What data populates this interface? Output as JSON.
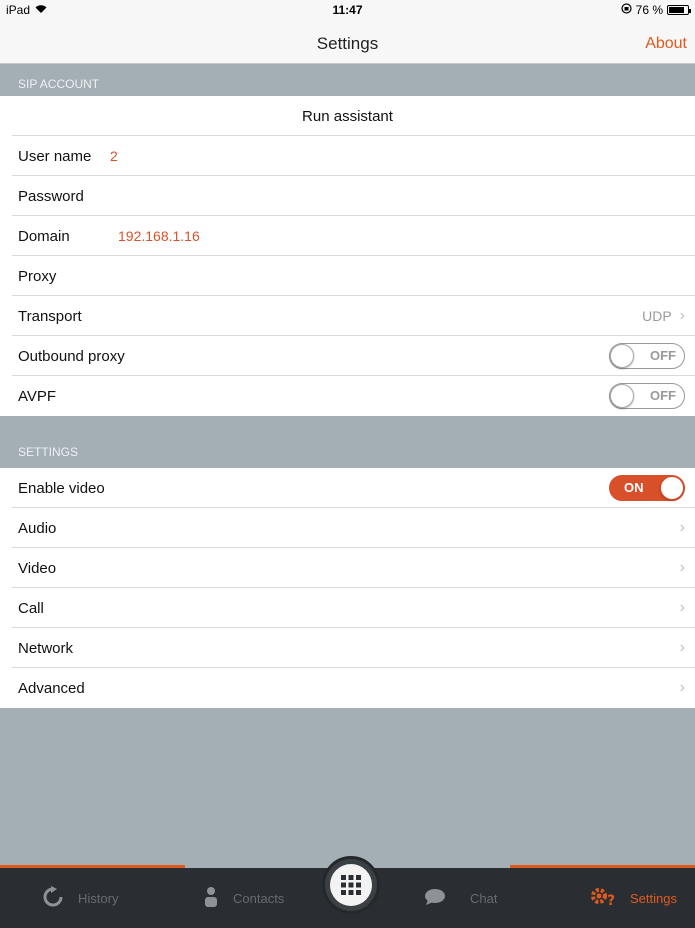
{
  "status_bar": {
    "device": "iPad",
    "time": "11:47",
    "battery": "76 %"
  },
  "nav": {
    "title": "Settings",
    "about": "About"
  },
  "sip_section": {
    "header": "SIP ACCOUNT"
  },
  "sip": {
    "run_assistant": "Run assistant",
    "username_label": "User name",
    "username_value": "2",
    "password_label": "Password",
    "domain_label": "Domain",
    "domain_value": "192.168.1.16",
    "proxy_label": "Proxy",
    "transport_label": "Transport",
    "transport_value": "UDP",
    "outbound_label": "Outbound proxy",
    "outbound_state": "OFF",
    "avpf_label": "AVPF",
    "avpf_state": "OFF"
  },
  "settings_section": {
    "header": "SETTINGS"
  },
  "settings": {
    "enable_video_label": "Enable video",
    "enable_video_state": "ON",
    "audio": "Audio",
    "video": "Video",
    "call": "Call",
    "network": "Network",
    "advanced": "Advanced"
  },
  "tabbar": {
    "history": "History",
    "contacts": "Contacts",
    "chat": "Chat",
    "settings": "Settings"
  },
  "colors": {
    "accent": "#e05a1e",
    "switch_on": "#d8502a",
    "section_bg": "#a4aeb5",
    "tabbar_bg": "#2a2e32"
  }
}
